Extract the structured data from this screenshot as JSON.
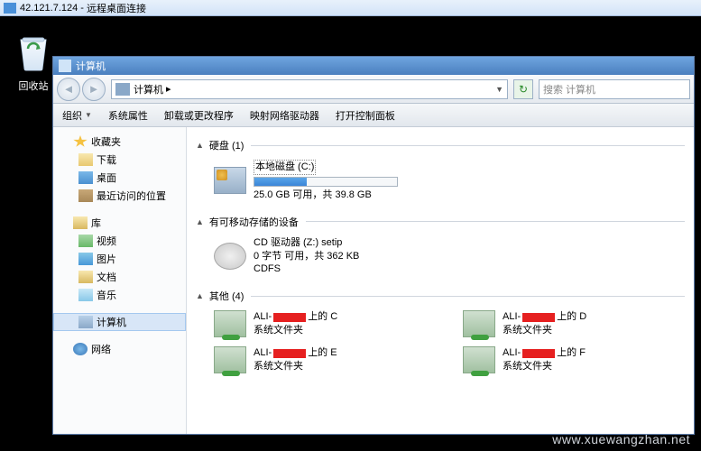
{
  "rdp": {
    "title_ip": "42.121.7.124",
    "title_app": "远程桌面连接"
  },
  "desktop": {
    "recycle_bin": "回收站"
  },
  "explorer": {
    "title": "计算机",
    "breadcrumb": "计算机",
    "search_placeholder": "搜索 计算机",
    "toolbar": {
      "organize": "组织",
      "properties": "系统属性",
      "uninstall": "卸载或更改程序",
      "mapdrive": "映射网络驱动器",
      "controlpanel": "打开控制面板"
    }
  },
  "sidebar": {
    "favorites": "收藏夹",
    "fav_items": {
      "downloads": "下载",
      "desktop": "桌面",
      "recent": "最近访问的位置"
    },
    "libraries": "库",
    "lib_items": {
      "videos": "视频",
      "pictures": "图片",
      "documents": "文档",
      "music": "音乐"
    },
    "computer": "计算机",
    "network": "网络"
  },
  "content": {
    "cat_hdd": "硬盘 (1)",
    "hdd": {
      "name": "本地磁盘 (C:)",
      "stats": "25.0 GB 可用，共 39.8 GB",
      "used_pct": 37
    },
    "cat_removable": "有可移动存储的设备",
    "cd": {
      "name": "CD 驱动器 (Z:) setip",
      "stats": "0 字节 可用，共 362 KB",
      "fs": "CDFS"
    },
    "cat_other": "其他 (4)",
    "map_prefix": "ALI-",
    "map_suffix_on": " 上的 ",
    "map_sub": "系统文件夹",
    "maps": [
      "C",
      "D",
      "E",
      "F"
    ]
  },
  "watermark": "www.xuewangzhan.net"
}
